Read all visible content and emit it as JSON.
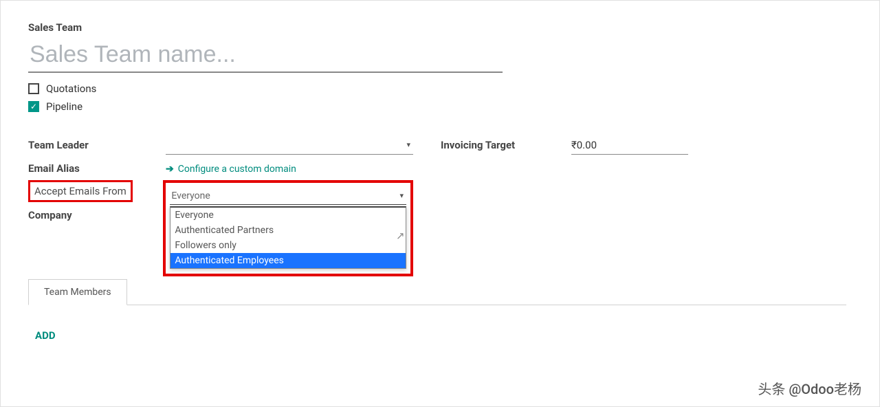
{
  "title_label": "Sales Team",
  "title_placeholder": "Sales Team name...",
  "checkboxes": {
    "quotations": {
      "label": "Quotations",
      "checked": false
    },
    "pipeline": {
      "label": "Pipeline",
      "checked": true
    }
  },
  "fields": {
    "team_leader_label": "Team Leader",
    "email_alias_label": "Email Alias",
    "configure_link": "Configure a custom domain",
    "accept_emails_label": "Accept Emails From",
    "company_label": "Company",
    "invoicing_target_label": "Invoicing Target",
    "invoicing_target_value": "₹0.00"
  },
  "accept_emails": {
    "selected": "Everyone",
    "options": [
      "Everyone",
      "Authenticated Partners",
      "Followers only",
      "Authenticated Employees"
    ],
    "highlighted_index": 3
  },
  "tabs": {
    "members": "Team Members"
  },
  "add_label": "ADD",
  "watermark": "头条 @Odoo老杨"
}
